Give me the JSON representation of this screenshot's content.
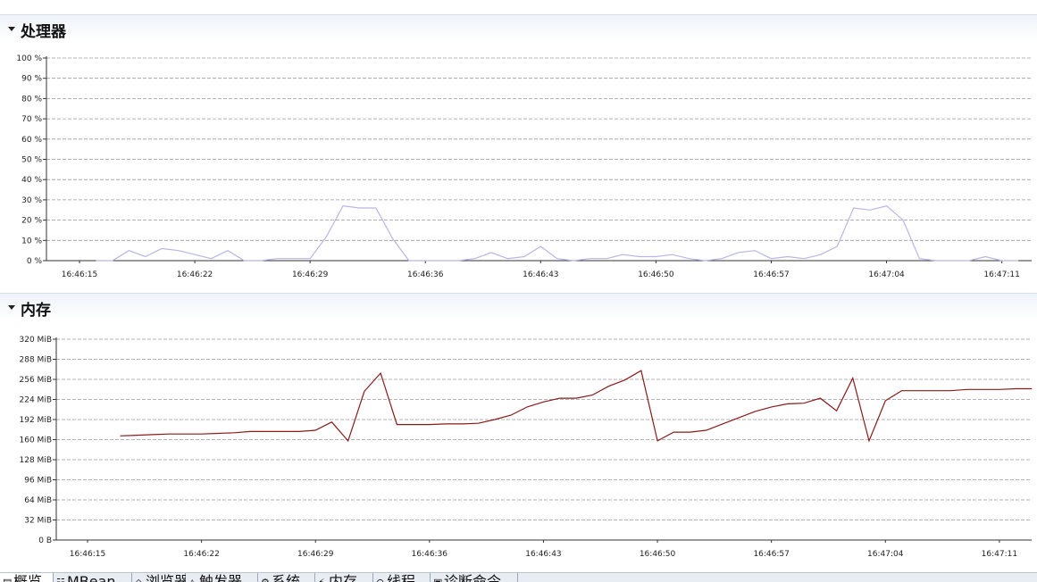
{
  "cpu": {
    "title": "处理器",
    "y_tick_labels": [
      "0 %",
      "10 %",
      "20 %",
      "30 %",
      "40 %",
      "50 %",
      "60 %",
      "70 %",
      "80 %",
      "90 %",
      "100 %"
    ],
    "x_tick_labels": [
      "16:46:15",
      "16:46:22",
      "16:46:29",
      "16:46:36",
      "16:46:43",
      "16:46:50",
      "16:46:57",
      "16:47:04",
      "16:47:11"
    ],
    "line_color": "#b9b5e6"
  },
  "memory": {
    "title": "内存",
    "y_tick_labels": [
      "0 B",
      "32 MiB",
      "64 MiB",
      "96 MiB",
      "128 MiB",
      "160 MiB",
      "192 MiB",
      "224 MiB",
      "256 MiB",
      "288 MiB",
      "320 MiB"
    ],
    "x_tick_labels": [
      "16:46:15",
      "16:46:22",
      "16:46:29",
      "16:46:36",
      "16:46:43",
      "16:46:50",
      "16:46:57",
      "16:47:04",
      "16:47:11"
    ],
    "line_color": "#8b1a1a"
  },
  "chart_data": [
    {
      "type": "line",
      "title": "处理器",
      "xlabel": "",
      "ylabel": "",
      "ylim": [
        0,
        100
      ],
      "grid": true,
      "x": [
        "16:46:16",
        "16:46:17",
        "16:46:18",
        "16:46:19",
        "16:46:20",
        "16:46:21",
        "16:46:22",
        "16:46:23",
        "16:46:24",
        "16:46:25",
        "16:46:26",
        "16:46:27",
        "16:46:28",
        "16:46:29",
        "16:46:30",
        "16:46:31",
        "16:46:32",
        "16:46:33",
        "16:46:34",
        "16:46:35",
        "16:46:36",
        "16:46:37",
        "16:46:38",
        "16:46:39",
        "16:46:40",
        "16:46:41",
        "16:46:42",
        "16:46:43",
        "16:46:44",
        "16:46:45",
        "16:46:46",
        "16:46:47",
        "16:46:48",
        "16:46:49",
        "16:46:50",
        "16:46:51",
        "16:46:52",
        "16:46:53",
        "16:46:54",
        "16:46:55",
        "16:46:56",
        "16:46:57",
        "16:46:58",
        "16:46:59",
        "16:47:00",
        "16:47:01",
        "16:47:02",
        "16:47:03",
        "16:47:04",
        "16:47:05",
        "16:47:06",
        "16:47:07",
        "16:47:08",
        "16:47:09",
        "16:47:10",
        "16:47:11",
        "16:47:12"
      ],
      "series": [
        {
          "values": [
            0,
            0,
            5,
            2,
            6,
            5,
            3,
            1,
            5,
            0,
            0,
            1,
            1,
            1,
            12,
            27,
            26,
            26,
            11,
            0,
            0,
            0,
            0,
            1,
            4,
            1,
            2,
            7,
            1,
            0,
            1,
            1,
            3,
            2,
            2,
            3,
            1,
            0,
            1,
            4,
            5,
            1,
            2,
            1,
            3,
            7,
            26,
            25,
            27,
            20,
            1,
            0,
            0,
            0,
            2,
            0,
            0
          ]
        }
      ]
    },
    {
      "type": "line",
      "title": "内存",
      "xlabel": "",
      "ylabel": "",
      "ylim": [
        0,
        320
      ],
      "grid": true,
      "x": [
        "16:46:17",
        "16:46:18",
        "16:46:19",
        "16:46:20",
        "16:46:21",
        "16:46:22",
        "16:46:23",
        "16:46:24",
        "16:46:25",
        "16:46:26",
        "16:46:27",
        "16:46:28",
        "16:46:28",
        "16:46:29",
        "16:46:30",
        "16:46:31",
        "16:46:32",
        "16:46:33",
        "16:46:34",
        "16:46:35",
        "16:46:36",
        "16:46:37",
        "16:46:38",
        "16:46:39",
        "16:46:40",
        "16:46:41",
        "16:46:42",
        "16:46:43",
        "16:46:44",
        "16:46:45",
        "16:46:46",
        "16:46:47",
        "16:46:48",
        "16:46:49",
        "16:46:50",
        "16:46:51",
        "16:46:52",
        "16:46:53",
        "16:46:54",
        "16:46:55",
        "16:46:56",
        "16:46:57",
        "16:46:58",
        "16:46:59",
        "16:47:00",
        "16:47:01",
        "16:47:02",
        "16:47:03",
        "16:47:04",
        "16:47:05",
        "16:47:06",
        "16:47:07",
        "16:47:08",
        "16:47:09",
        "16:47:10",
        "16:47:11",
        "16:47:12",
        "16:47:13"
      ],
      "series": [
        {
          "values": [
            166,
            167,
            168,
            169,
            169,
            169,
            170,
            171,
            173,
            173,
            173,
            173,
            173,
            175,
            188,
            158,
            237,
            266,
            184,
            184,
            184,
            185,
            185,
            186,
            192,
            199,
            212,
            220,
            226,
            226,
            231,
            245,
            255,
            270,
            158,
            172,
            172,
            175,
            185,
            195,
            205,
            212,
            217,
            218,
            226,
            206,
            258,
            158,
            222,
            238,
            238,
            238,
            238,
            240,
            240,
            240,
            241,
            241
          ]
        }
      ]
    }
  ],
  "tabs": [
    {
      "label": "概览",
      "icon": "▤"
    },
    {
      "label": "MBean",
      "icon": "☷"
    },
    {
      "label": "浏览器",
      "icon": "◇"
    },
    {
      "label": "触发器",
      "icon": "△"
    },
    {
      "label": "系统",
      "icon": "⚙"
    },
    {
      "label": "内存",
      "icon": "⚡"
    },
    {
      "label": "线程",
      "icon": "⊙"
    },
    {
      "label": "诊断命令",
      "icon": "▣"
    }
  ]
}
